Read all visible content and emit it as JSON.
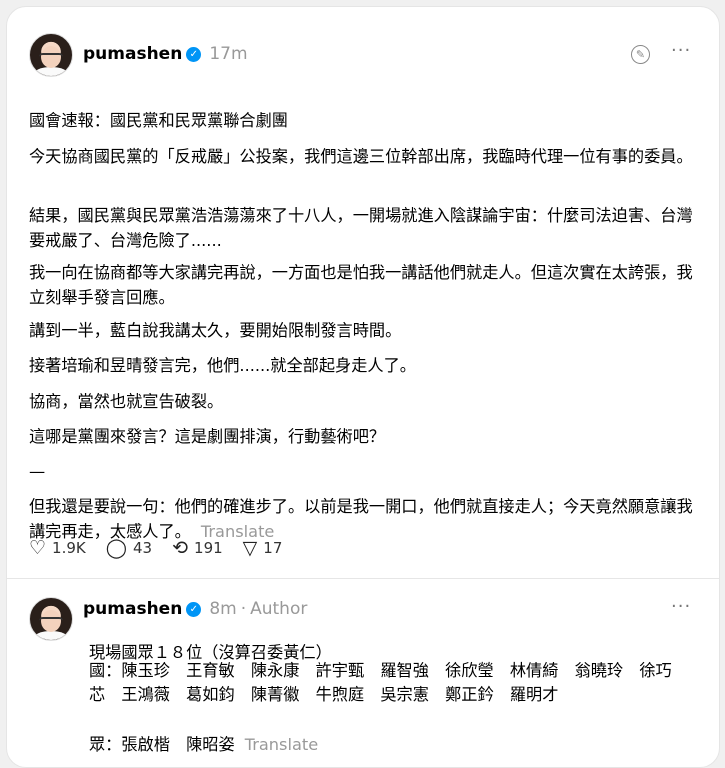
{
  "post1": {
    "username": "pumashen",
    "time": "17m",
    "paragraphs": [
      "國會速報：國民黨和民眾黨聯合劇團",
      "今天協商國民黨的「反戒嚴」公投案，我們這邊三位幹部出席，我臨時代理一位有事的委員。",
      "結果，國民黨與民眾黨浩浩蕩蕩來了十八人，一開場就進入陰謀論宇宙：什麼司法迫害、台灣要戒嚴了、台灣危險了......",
      "我一向在協商都等大家講完再說，一方面也是怕我一講話他們就走人。但這次實在太誇張，我立刻舉手發言回應。",
      "講到一半，藍白說我講太久，要開始限制發言時間。",
      "接著培瑜和昱晴發言完，他們......就全部起身走人了。",
      "協商，當然也就宣告破裂。",
      "這哪是黨團來發言？這是劇團排演，行動藝術吧？",
      "—",
      "但我還是要說一句：他們的確進步了。以前是我一開口，他們就直接走人；今天竟然願意讓我講完再走，太感人了。"
    ],
    "translate": "Translate",
    "likes": "1.9K",
    "replies": "43",
    "reposts": "191",
    "shares": "17"
  },
  "post2": {
    "username": "pumashen",
    "time": "8m",
    "separator": "·",
    "author_label": "Author",
    "line1": "現場國眾１８位（沒算召委黃仁）",
    "kmt_line1": "國：陳玉珍　王育敏　陳永康　許宇甄　羅智強　徐欣瑩　林倩綺　翁曉玲　徐巧",
    "kmt_line2": "芯　王鴻薇　葛如鈞　陳菁徽　牛煦庭　吳宗憲　鄭正鈐　羅明才",
    "tpp_line": "眾：張啟楷　陳昭姿",
    "translate": "Translate"
  },
  "icons": {
    "verified": "verified-check-icon",
    "edit": "edit-circle-icon",
    "more": "more-dots-icon",
    "like": "heart-icon",
    "reply": "comment-icon",
    "repost": "repost-icon",
    "share": "send-icon"
  },
  "colors": {
    "accent": "#0095f6",
    "muted": "#999999"
  }
}
